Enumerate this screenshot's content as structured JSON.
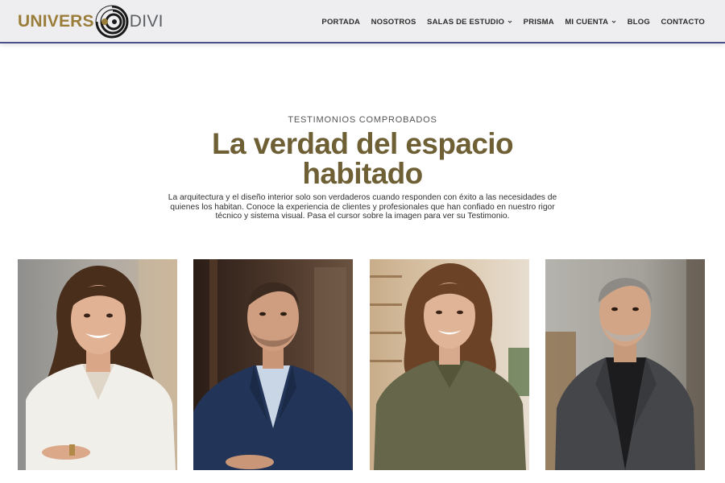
{
  "header": {
    "logo": {
      "left_text": "UNIVERS",
      "right_text": "DIVI"
    },
    "nav": [
      {
        "label": "PORTADA",
        "has_dropdown": false
      },
      {
        "label": "NOSOTROS",
        "has_dropdown": false
      },
      {
        "label": "SALAS DE ESTUDIO",
        "has_dropdown": true
      },
      {
        "label": "PRISMA",
        "has_dropdown": false
      },
      {
        "label": "MI CUENTA",
        "has_dropdown": true
      },
      {
        "label": "BLOG",
        "has_dropdown": false
      },
      {
        "label": "CONTACTO",
        "has_dropdown": false
      }
    ],
    "accent_color": "#4a4f8c"
  },
  "hero": {
    "eyebrow": "TESTIMONIOS COMPROBADOS",
    "title_line1": "La verdad del espacio",
    "title_line2": "habitado",
    "intro_line1": "La arquitectura y el diseño interior solo son verdaderos cuando responden con éxito a las necesidades de",
    "intro_line2": "quienes los habitan. Conoce la experiencia de clientes y profesionales que han confiado en nuestro rigor",
    "intro_line3": "técnico y sistema visual. Pasa el cursor sobre la imagen para ver su Testimonio.",
    "title_color": "#6e5f35"
  },
  "testimonials": [
    {
      "photo": "woman-white-blouse-portrait"
    },
    {
      "photo": "man-navy-suit-portrait"
    },
    {
      "photo": "woman-olive-shirt-portrait"
    },
    {
      "photo": "older-man-grey-blazer-portrait"
    }
  ],
  "colors": {
    "brand_gold": "#9a7d3a",
    "brand_grey": "#5c5f63",
    "header_bg": "#eeeef0"
  }
}
